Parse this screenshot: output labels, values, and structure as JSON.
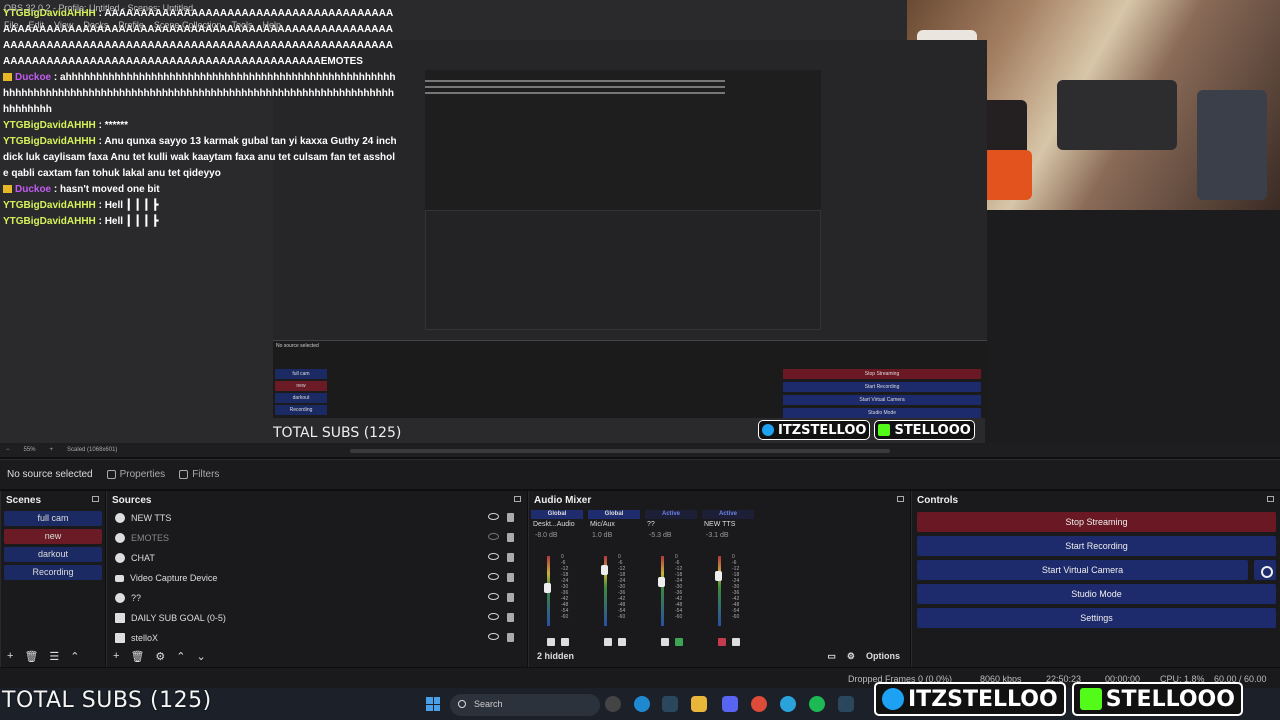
{
  "window": {
    "title": "OBS 32.0.2 - Profile: Untitled - Scenes: Untitled",
    "menu": [
      "File",
      "Edit",
      "View",
      "Docks",
      "Profile",
      "Scene Collection",
      "Tools",
      "Help"
    ]
  },
  "chat": [
    {
      "user": "YTGBigDavidAHHH",
      "user_color": "#d6f25a",
      "text": "AAAAAAAAAAAAAAAAAAAAAAAAAAAAAAAAAAAAAAAAAAAAAAAAAAAAAAAAAAAAAAAAAAAAAAAAAAAAAAAAAAAAAAAAAAAAAAAAAAAAAAAAAAAAAAAAAAAAAAAAAAAAAAAAAAAAAAAAAAAAAAAAAAAAAAAAAAAAAAAAAAAAAAAAAAAAAAAAAAAAAAAAAAAAAAAAEMOTES"
    },
    {
      "user": "Duckoe",
      "user_color": "#c35cf2",
      "badge": true,
      "text": "ahhhhhhhhhhhhhhhhhhhhhhhhhhhhhhhhhhhhhhhhhhhhhhhhhhhhhhhhhhhhhhhhhhhhhhhhhhhhhhhhhhhhhhhhhhhhhhhhhhhhhhhhhhhhhhhhhhhhhhhhhhhhhh"
    },
    {
      "user": "YTGBigDavidAHHH",
      "user_color": "#d6f25a",
      "text": "******"
    },
    {
      "user": "YTGBigDavidAHHH",
      "user_color": "#d6f25a",
      "text": "Anu qunxa sayyo 13 karmak gubal tan yi kaxxa Guthy 24 inch dick luk caylisam faxa Anu tet kulli wak kaaytam faxa anu tet culsam fan tet asshole qabli caxtam fan tohuk lakal anu tet qideyyo"
    },
    {
      "user": "Duckoe",
      "user_color": "#c35cf2",
      "badge": true,
      "text": "hasn't moved one bit"
    },
    {
      "user": "YTGBigDavidAHHH",
      "user_color": "#d6f25a",
      "text": "Hell ┃ ┃ ┃ ┣"
    },
    {
      "user": "YTGBigDavidAHHH",
      "user_color": "#d6f25a",
      "text": "Hell ┃ ┃ ┃ ┣"
    }
  ],
  "preview_bar": {
    "zoom": "55%",
    "scaled": "Scaled (1068x601)"
  },
  "info": {
    "no_source": "No source selected",
    "properties": "Properties",
    "filters": "Filters"
  },
  "scenes": {
    "title": "Scenes",
    "items": [
      {
        "label": "full cam",
        "active": false
      },
      {
        "label": "new",
        "active": true
      },
      {
        "label": "darkout",
        "active": false
      },
      {
        "label": "Recording",
        "active": false
      }
    ]
  },
  "sources": {
    "title": "Sources",
    "items": [
      {
        "label": "NEW TTS",
        "icon": "browser-icon",
        "visible": true
      },
      {
        "label": "EMOTES",
        "icon": "browser-icon",
        "visible": false
      },
      {
        "label": "CHAT",
        "icon": "browser-icon",
        "visible": true
      },
      {
        "label": "Video Capture Device",
        "icon": "camera-icon",
        "visible": true
      },
      {
        "label": "??",
        "icon": "browser-icon",
        "visible": true
      },
      {
        "label": "DAILY SUB GOAL (0-5)",
        "icon": "text-icon",
        "visible": true
      },
      {
        "label": "stelloX",
        "icon": "image-icon",
        "visible": true
      }
    ]
  },
  "mixer": {
    "title": "Audio Mixer",
    "channels": [
      {
        "tab": "Global",
        "tab_active": false,
        "name": "Deskt...Audio",
        "db": "-8.0 dB",
        "level": 0.55,
        "headphone": false,
        "muted": false
      },
      {
        "tab": "Global",
        "tab_active": false,
        "name": "Mic/Aux",
        "db": "1.0 dB",
        "level": 0.85,
        "headphone": false,
        "muted": false
      },
      {
        "tab": "Active",
        "tab_active": true,
        "name": "??",
        "db": "-5.3 dB",
        "level": 0.65,
        "headphone": true,
        "muted": false
      },
      {
        "tab": "Active",
        "tab_active": true,
        "name": "NEW TTS",
        "db": "-3.1 dB",
        "level": 0.75,
        "headphone": false,
        "muted": true
      }
    ],
    "scale": [
      "0",
      "-6",
      "-12",
      "-18",
      "-24",
      "-30",
      "-36",
      "-42",
      "-48",
      "-54",
      "-60"
    ],
    "hidden": "2 hidden",
    "options": "Options"
  },
  "controls": {
    "title": "Controls",
    "buttons": [
      "Stop Streaming",
      "Start Recording",
      "Start Virtual Camera",
      "Studio Mode",
      "Settings"
    ]
  },
  "status": {
    "dropped": "Dropped Frames 0 (0.0%)",
    "kbps": "8060 kbps",
    "live_time": "22:50:23",
    "rec_time": "00:00:00",
    "cpu": "CPU: 1.8%",
    "fps": "60.00 / 60.00 FPS"
  },
  "taskbar": {
    "search": "Search"
  },
  "overlay": {
    "total_subs": "TOTAL SUBS (125)",
    "brand1": "ITZSTELLOO",
    "brand2": "STELLOOO"
  },
  "colors": {
    "accent": "#1d2a6b",
    "stop": "#6a1824",
    "chat_user": "#d6f25a",
    "chat_mod": "#c35cf2",
    "kick": "#53fc18",
    "twitter": "#1da1f2"
  }
}
